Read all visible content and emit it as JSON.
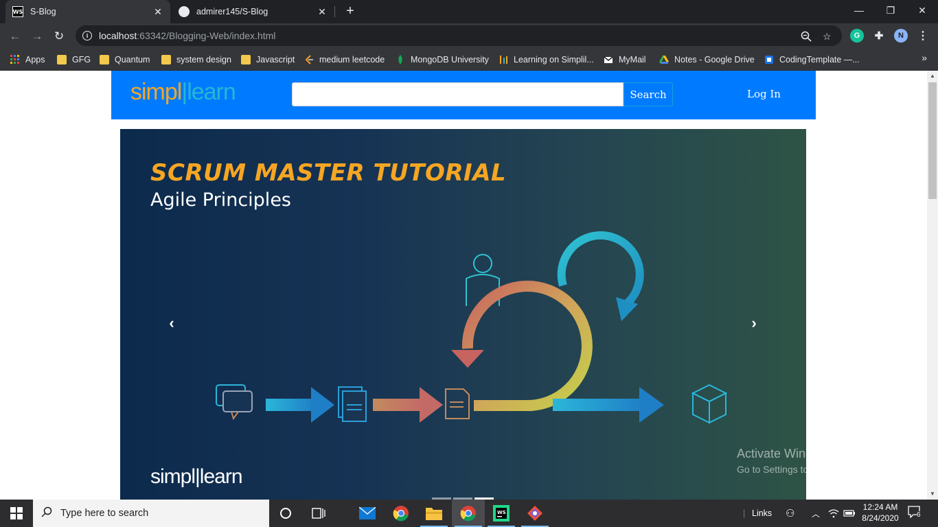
{
  "browser": {
    "tabs": [
      {
        "title": "S-Blog",
        "active": true,
        "favicon": "webstorm-icon"
      },
      {
        "title": "admirer145/S-Blog",
        "active": false,
        "favicon": "github-icon"
      }
    ],
    "url_host": "localhost",
    "url_rest": ":63342/Blogging-Web/index.html",
    "profile_initial": "N",
    "grammarly_initial": "G"
  },
  "bookmarks": [
    {
      "label": "Apps",
      "icon": "apps-grid-icon"
    },
    {
      "label": "GFG",
      "icon": "folder-icon"
    },
    {
      "label": "Quantum",
      "icon": "folder-icon"
    },
    {
      "label": "system design",
      "icon": "folder-icon"
    },
    {
      "label": "Javascript",
      "icon": "folder-icon"
    },
    {
      "label": "medium leetcode",
      "icon": "leetcode-icon"
    },
    {
      "label": "MongoDB University",
      "icon": "mongodb-leaf-icon"
    },
    {
      "label": "Learning on Simplil...",
      "icon": "simplilearn-icon"
    },
    {
      "label": "MyMail",
      "icon": "mail-icon"
    },
    {
      "label": "Notes - Google Drive",
      "icon": "google-drive-icon"
    },
    {
      "label": "CodingTemplate —...",
      "icon": "bookmark-icon"
    }
  ],
  "site": {
    "logo_part1": "simpl",
    "logo_part2": "learn",
    "search_button": "Search",
    "search_placeholder": "",
    "login_link": "Log In",
    "colors": {
      "navbar": "#007bff",
      "logo_orange": "#f6a623",
      "logo_blue": "#25b7d3"
    }
  },
  "carousel": {
    "slide_title": "SCRUM MASTER TUTORIAL",
    "slide_subtitle": "Agile Principles",
    "slide_footer_logo": "simpl|learn",
    "prev_icon": "chevron-left-icon",
    "next_icon": "chevron-right-icon",
    "indicator_count": 3,
    "active_indicator": 3
  },
  "watermark": {
    "line1": "Activate Windows",
    "line2": "Go to Settings to activate Windows."
  },
  "taskbar": {
    "search_placeholder": "Type here to search",
    "links_label": "Links",
    "time": "12:24 AM",
    "date": "8/24/2020",
    "notification_count": "6"
  }
}
